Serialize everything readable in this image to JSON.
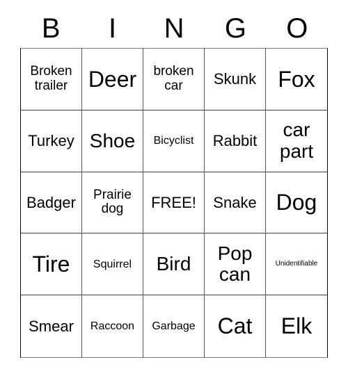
{
  "card": {
    "title": "BINGO",
    "headers": [
      "B",
      "I",
      "N",
      "G",
      "O"
    ],
    "rows": [
      [
        {
          "label": "Broken\ntrailer",
          "size": "fs-sm"
        },
        {
          "label": "Deer",
          "size": "fs-xl"
        },
        {
          "label": "broken\ncar",
          "size": "fs-sm"
        },
        {
          "label": "Skunk",
          "size": "fs-md"
        },
        {
          "label": "Fox",
          "size": "fs-xl"
        }
      ],
      [
        {
          "label": "Turkey",
          "size": "fs-md"
        },
        {
          "label": "Shoe",
          "size": "fs-lg"
        },
        {
          "label": "Bicyclist",
          "size": "fs-xs"
        },
        {
          "label": "Rabbit",
          "size": "fs-md"
        },
        {
          "label": "car\npart",
          "size": "fs-lg"
        }
      ],
      [
        {
          "label": "Badger",
          "size": "fs-md"
        },
        {
          "label": "Prairie\ndog",
          "size": "fs-sm"
        },
        {
          "label": "FREE!",
          "size": "fs-md"
        },
        {
          "label": "Snake",
          "size": "fs-md"
        },
        {
          "label": "Dog",
          "size": "fs-xl"
        }
      ],
      [
        {
          "label": "Tire",
          "size": "fs-xl"
        },
        {
          "label": "Squirrel",
          "size": "fs-xs"
        },
        {
          "label": "Bird",
          "size": "fs-lg"
        },
        {
          "label": "Pop\ncan",
          "size": "fs-lg"
        },
        {
          "label": "Unidentifiable",
          "size": "fs-xxs"
        }
      ],
      [
        {
          "label": "Smear",
          "size": "fs-md"
        },
        {
          "label": "Raccoon",
          "size": "fs-xs"
        },
        {
          "label": "Garbage",
          "size": "fs-xs"
        },
        {
          "label": "Cat",
          "size": "fs-xl"
        },
        {
          "label": "Elk",
          "size": "fs-xl"
        }
      ]
    ],
    "colors": {
      "background": "#ffffff",
      "text": "#000000",
      "grid_line": "#555555",
      "outer_border": "#000000"
    }
  }
}
